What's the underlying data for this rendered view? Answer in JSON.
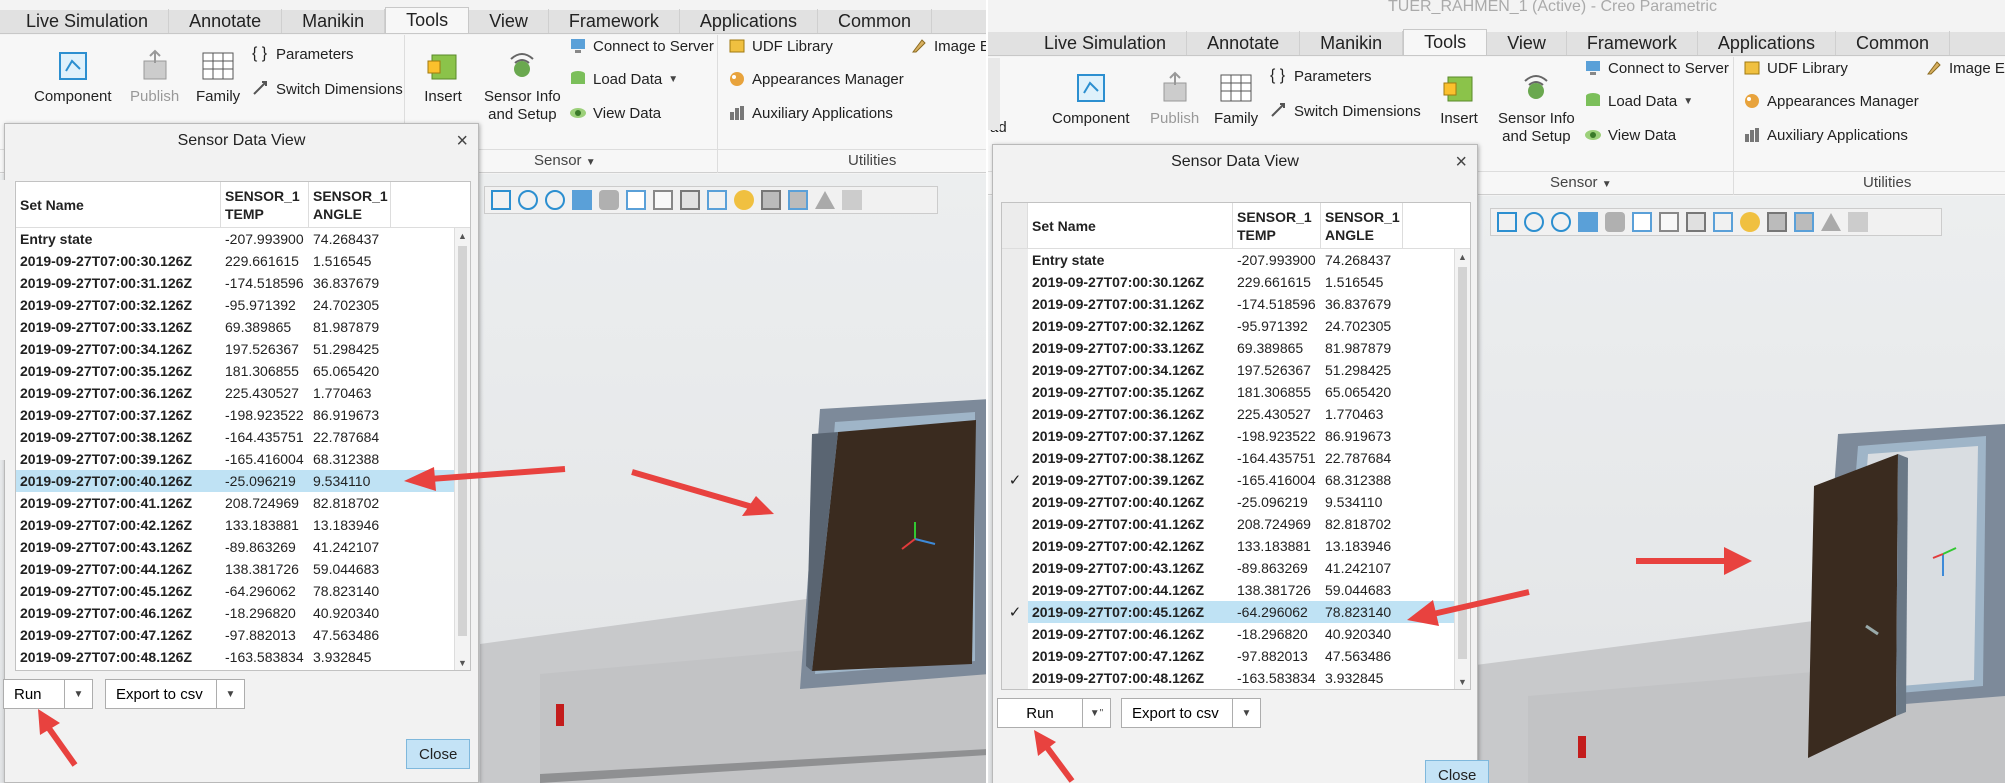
{
  "ribbon": {
    "tabs": [
      "Live Simulation",
      "Annotate",
      "Manikin",
      "Tools",
      "View",
      "Framework",
      "Applications",
      "Common"
    ],
    "active_tab": "Tools",
    "buttons": {
      "component": "Component",
      "publish": "Publish",
      "family": "Family",
      "parameters": "Parameters",
      "switch_dimensions": "Switch Dimensions",
      "insert": "Insert",
      "sensor_info": "Sensor Info\nand Setup",
      "connect_to_server": "Connect to Server",
      "load_data": "Load Data",
      "view_data": "View Data",
      "udf_library": "UDF Library",
      "appearances_manager": "Appearances Manager",
      "auxiliary_applications": "Auxiliary Applications",
      "image_editor": "Image E"
    },
    "groups": {
      "sensor": "Sensor",
      "utilities": "Utilities"
    }
  },
  "window_title": "TUER_RAHMEN_1 (Active) - Creo Parametric",
  "right_cut_labels": {
    "ad": "ad"
  },
  "dialog": {
    "title": "Sensor Data View",
    "columns": [
      "Set Name",
      "SENSOR_1\nTEMP",
      "SENSOR_1\nANGLE"
    ],
    "rows": [
      [
        "Entry state",
        "-207.993900",
        "74.268437"
      ],
      [
        "2019-09-27T07:00:30.126Z",
        "229.661615",
        "1.516545"
      ],
      [
        "2019-09-27T07:00:31.126Z",
        "-174.518596",
        "36.837679"
      ],
      [
        "2019-09-27T07:00:32.126Z",
        "-95.971392",
        "24.702305"
      ],
      [
        "2019-09-27T07:00:33.126Z",
        "69.389865",
        "81.987879"
      ],
      [
        "2019-09-27T07:00:34.126Z",
        "197.526367",
        "51.298425"
      ],
      [
        "2019-09-27T07:00:35.126Z",
        "181.306855",
        "65.065420"
      ],
      [
        "2019-09-27T07:00:36.126Z",
        "225.430527",
        "1.770463"
      ],
      [
        "2019-09-27T07:00:37.126Z",
        "-198.923522",
        "86.919673"
      ],
      [
        "2019-09-27T07:00:38.126Z",
        "-164.435751",
        "22.787684"
      ],
      [
        "2019-09-27T07:00:39.126Z",
        "-165.416004",
        "68.312388"
      ],
      [
        "2019-09-27T07:00:40.126Z",
        "-25.096219",
        "9.534110"
      ],
      [
        "2019-09-27T07:00:41.126Z",
        "208.724969",
        "82.818702"
      ],
      [
        "2019-09-27T07:00:42.126Z",
        "133.183881",
        "13.183946"
      ],
      [
        "2019-09-27T07:00:43.126Z",
        "-89.863269",
        "41.242107"
      ],
      [
        "2019-09-27T07:00:44.126Z",
        "138.381726",
        "59.044683"
      ],
      [
        "2019-09-27T07:00:45.126Z",
        "-64.296062",
        "78.823140"
      ],
      [
        "2019-09-27T07:00:46.126Z",
        "-18.296820",
        "40.920340"
      ],
      [
        "2019-09-27T07:00:47.126Z",
        "-97.882013",
        "47.563486"
      ],
      [
        "2019-09-27T07:00:48.126Z",
        "-163.583834",
        "3.932845"
      ]
    ],
    "run_label": "Run",
    "export_label": "Export to csv",
    "close_label": "Close"
  },
  "left_state": {
    "selected_row": 11
  },
  "right_state": {
    "selected_row": 16,
    "checked_rows": [
      10,
      16
    ]
  },
  "colors": {
    "annotation_arrow": "#e8423f",
    "selection": "#bfe2f4",
    "door": "#3a2a1e",
    "frame": "#6b7a8c"
  }
}
